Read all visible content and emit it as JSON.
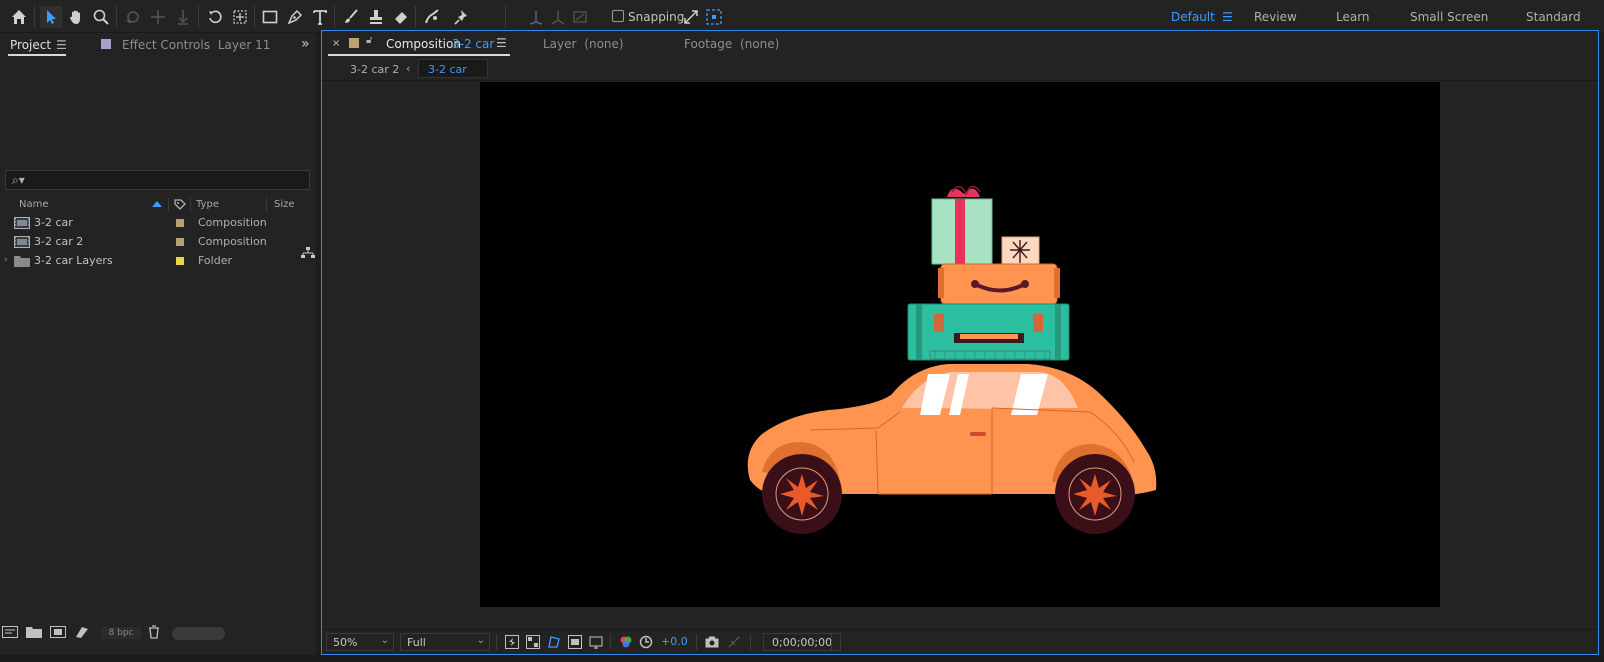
{
  "toolbar": {
    "snapping_label": "Snapping",
    "workspaces": [
      "Default",
      "Review",
      "Learn",
      "Small Screen",
      "Standard"
    ],
    "active_workspace": "Default",
    "icons": [
      "home-icon",
      "selection-tool-icon",
      "hand-tool-icon",
      "zoom-tool-icon",
      "orbit-camera-icon",
      "pan-camera-icon",
      "dolly-camera-icon",
      "rotation-tool-icon",
      "pan-behind-icon",
      "rectangle-tool-icon",
      "pen-tool-icon",
      "type-tool-icon",
      "brush-tool-icon",
      "clone-stamp-icon",
      "eraser-tool-icon",
      "roto-brush-icon",
      "puppet-pin-icon"
    ]
  },
  "project_panel": {
    "tab_project": "Project",
    "tab_effect_controls": "Effect Controls",
    "effect_controls_layer": "Layer 11",
    "search_placeholder": "",
    "columns": {
      "name": "Name",
      "type": "Type",
      "size": "Size"
    },
    "items": [
      {
        "name": "3-2 car",
        "type": "Composition",
        "label_color": "#b9a072",
        "kind": "composition"
      },
      {
        "name": "3-2 car 2",
        "type": "Composition",
        "label_color": "#b9a072",
        "kind": "composition"
      },
      {
        "name": "3-2 car Layers",
        "type": "Folder",
        "label_color": "#e8d44d",
        "kind": "folder"
      }
    ],
    "bit_depth": "8 bpc"
  },
  "composition_panel": {
    "tab_prefix": "Composition",
    "active_comp": "3-2 car",
    "layer_tab": "Layer",
    "layer_value": "(none)",
    "footage_tab": "Footage",
    "footage_value": "(none)",
    "breadcrumbs": [
      "3-2 car 2",
      "3-2 car"
    ],
    "magnification": "50%",
    "resolution": "Full",
    "exposure": "+0.0",
    "timecode": "0;00;00;00"
  },
  "colors": {
    "accent": "#3d9cff",
    "panel_bg": "#232323",
    "car_body": "#ff9350",
    "suitcase_teal": "#2bbf9f",
    "gift_mint": "#a8e2c4",
    "gift_ribbon": "#e8345a"
  }
}
